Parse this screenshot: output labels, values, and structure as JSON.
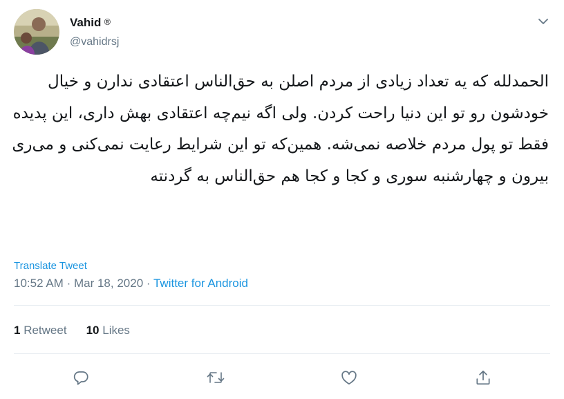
{
  "author": {
    "display_name": "Vahid",
    "badge": "®",
    "handle": "@vahidrsj"
  },
  "tweet": {
    "text": "الحمدلله که یه تعداد زیادی از مردم اصلن به حق‌الناس اعتقادی ندارن و خیال خودشون رو تو این دنیا راحت کردن. ولی اگه نیم‌چه اعتقادی بهش داری، این پدیده فقط تو پول مردم خلاصه نمی‌شه. همین‌که تو این شرایط رعایت نمی‌کنی و می‌ری بیرون و چهارشنبه سوری و کجا و کجا هم حق‌الناس به گردنته",
    "translate_label": "Translate Tweet",
    "time": "10:52 AM",
    "separator": "·",
    "date": "Mar 18, 2020",
    "source": "Twitter for Android"
  },
  "stats": {
    "retweet_count": "1",
    "retweet_label": "Retweet",
    "like_count": "10",
    "like_label": "Likes"
  },
  "actions": [
    "reply-icon",
    "retweet-icon",
    "like-icon",
    "share-icon"
  ],
  "colors": {
    "accent": "#1b95e0",
    "text": "#14171a",
    "secondary": "#657786",
    "divider": "#e6ecf0"
  }
}
